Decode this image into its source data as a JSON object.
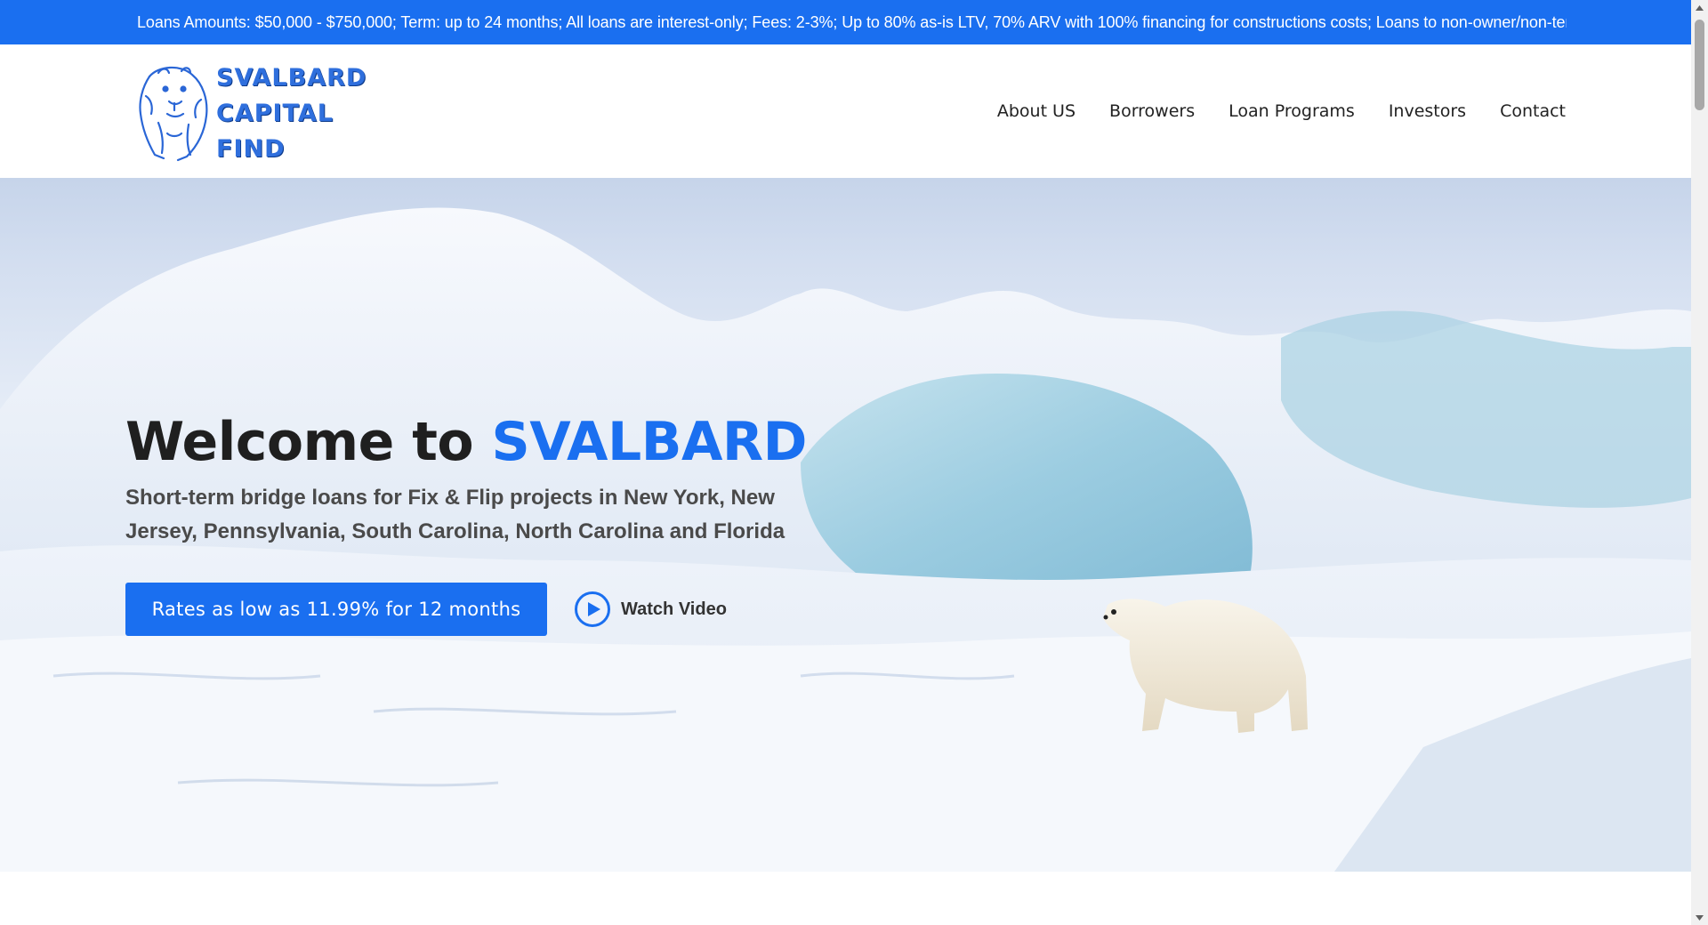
{
  "ticker": {
    "text": "Loans Amounts: $50,000 - $750,000; Term: up to 24 months; All loans are interest-only; Fees: 2-3%; Up to 80% as-is LTV, 70% ARV with 100% financing for constructions costs; Loans to non-owner/non-tenanted"
  },
  "logo": {
    "line1": "SVALBARD",
    "line2": "CAPITAL",
    "line3": "FIND",
    "icon": "polar-bear-icon"
  },
  "nav": {
    "items": [
      {
        "label": "About US"
      },
      {
        "label": "Borrowers"
      },
      {
        "label": "Loan Programs"
      },
      {
        "label": "Investors"
      },
      {
        "label": "Contact"
      }
    ]
  },
  "hero": {
    "title_prefix": "Welcome to ",
    "title_accent": "SVALBARD",
    "subtitle": "Short-term bridge loans for Fix & Flip projects in New York, New Jersey, Pennsylvania, South Carolina, North Carolina and Florida",
    "cta_label": "Rates as low as 11.99% for 12 months",
    "watch_label": "Watch Video",
    "watch_icon": "play-icon"
  },
  "colors": {
    "accent": "#1a6ff0",
    "heading": "#1f1f1f",
    "subtext": "#4a4a4a"
  }
}
